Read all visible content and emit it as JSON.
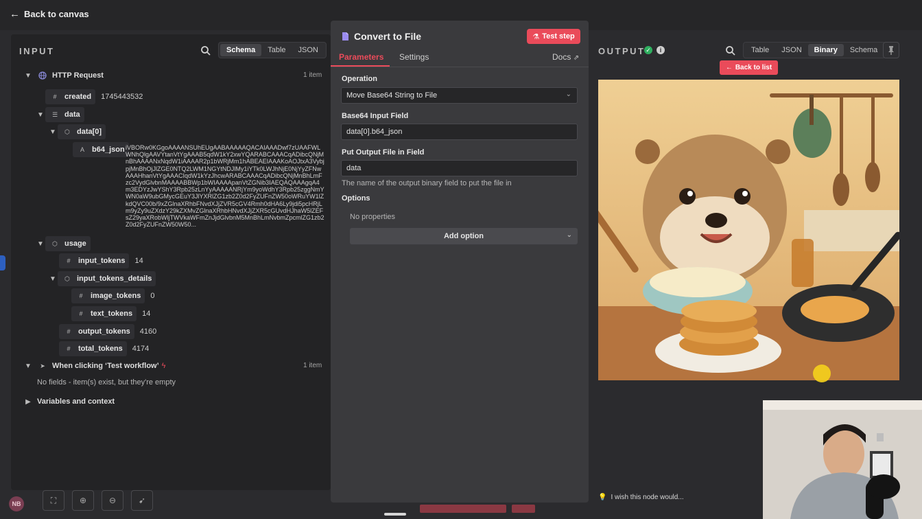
{
  "topbar": {
    "back_label": "Back to canvas"
  },
  "input": {
    "title": "INPUT",
    "tabs": [
      "Schema",
      "Table",
      "JSON"
    ],
    "active_tab": "Schema",
    "tree": {
      "http_request": {
        "label": "HTTP Request",
        "count": "1 item"
      },
      "created": {
        "key": "created",
        "value": "1745443532"
      },
      "data": {
        "key": "data"
      },
      "data0": {
        "key": "data[0]"
      },
      "b64": {
        "key": "b64_json",
        "value": "iVBORw0KGgoAAAANSUhEUgAABAAAAAQACAIAAADwf7zUAAFWLWNhQlgAAVYtanVtYgAAAB5qdW1kY2xwYQARABCAAACqADibcQNjMnBhAAAANxNqdW1iAAAAR2p1bWRjMm1hABEAEIAAAKoAOJtxA3VybjpjMnBhOjJlZGE0NTQ2LWM1NGYtNDJlMy1iYTk0LWJhNjE0NjYyZFNwAAAHhanVtYgAAACIqdW1kYzJhcwARABCAAACqADibcQNjMnBhLmFzc2VydGlvbnMAAAABBWp1bWIAAAApanVtZGNib3IAEQAQAAAgqA4m3EDYzJwYShY3Rpb25zLnYyAAAAANRjYm9yoWdhY3Rpb25zggNmYWN0aW9ubGMycGEuY3JlYXRlZG1zb2Z0d2FyZUFnZW50oWRuYW1lZkdQVC00b/9xZGlnaXRhbFNvdXJjZVR5cGV4Rmh0dHA6Ly9jdi5pcHRjLm9yZy9uZXdzY29kZXMvZGlnaXRhbHNvdXJjZXR5cGUvdHJhaW5lZEFsZ29yaXRobWljTWVkaWFmZnJjdGlvbnM5MnBhLmNvbmZpcmlZG1zb2Z0d2FyZUFnZW50W50..."
      },
      "usage": {
        "key": "usage"
      },
      "input_tokens": {
        "key": "input_tokens",
        "value": "14"
      },
      "input_tokens_details": {
        "key": "input_tokens_details"
      },
      "image_tokens": {
        "key": "image_tokens",
        "value": "0"
      },
      "text_tokens": {
        "key": "text_tokens",
        "value": "14"
      },
      "output_tokens": {
        "key": "output_tokens",
        "value": "4160"
      },
      "total_tokens": {
        "key": "total_tokens",
        "value": "4174"
      },
      "trigger": {
        "label": "When clicking ‘Test workflow’",
        "count": "1 item",
        "empty": "No fields - item(s) exist, but they're empty"
      },
      "variables": {
        "label": "Variables and context"
      }
    }
  },
  "node": {
    "title": "Convert to File",
    "test_button": "Test step",
    "tabs": {
      "parameters": "Parameters",
      "settings": "Settings",
      "docs": "Docs"
    },
    "operation": {
      "label": "Operation",
      "value": "Move Base64 String to File"
    },
    "base64_field": {
      "label": "Base64 Input Field",
      "value": "data[0].b64_json"
    },
    "output_field": {
      "label": "Put Output File in Field",
      "value": "data",
      "hint": "The name of the output binary field to put the file in"
    },
    "options": {
      "label": "Options",
      "empty": "No properties",
      "add_label": "Add option"
    }
  },
  "output": {
    "title": "OUTPUT",
    "tabs": [
      "Table",
      "JSON",
      "Binary",
      "Schema"
    ],
    "active_tab": "Binary",
    "back_label": "Back to list"
  },
  "footer": {
    "wish_text": "I wish this node would...",
    "avatar_initials": "NB"
  },
  "colors": {
    "accent": "#ea4b5a",
    "success": "#2fae5f",
    "panel": "#232325",
    "dialog": "#3a3a3d"
  }
}
